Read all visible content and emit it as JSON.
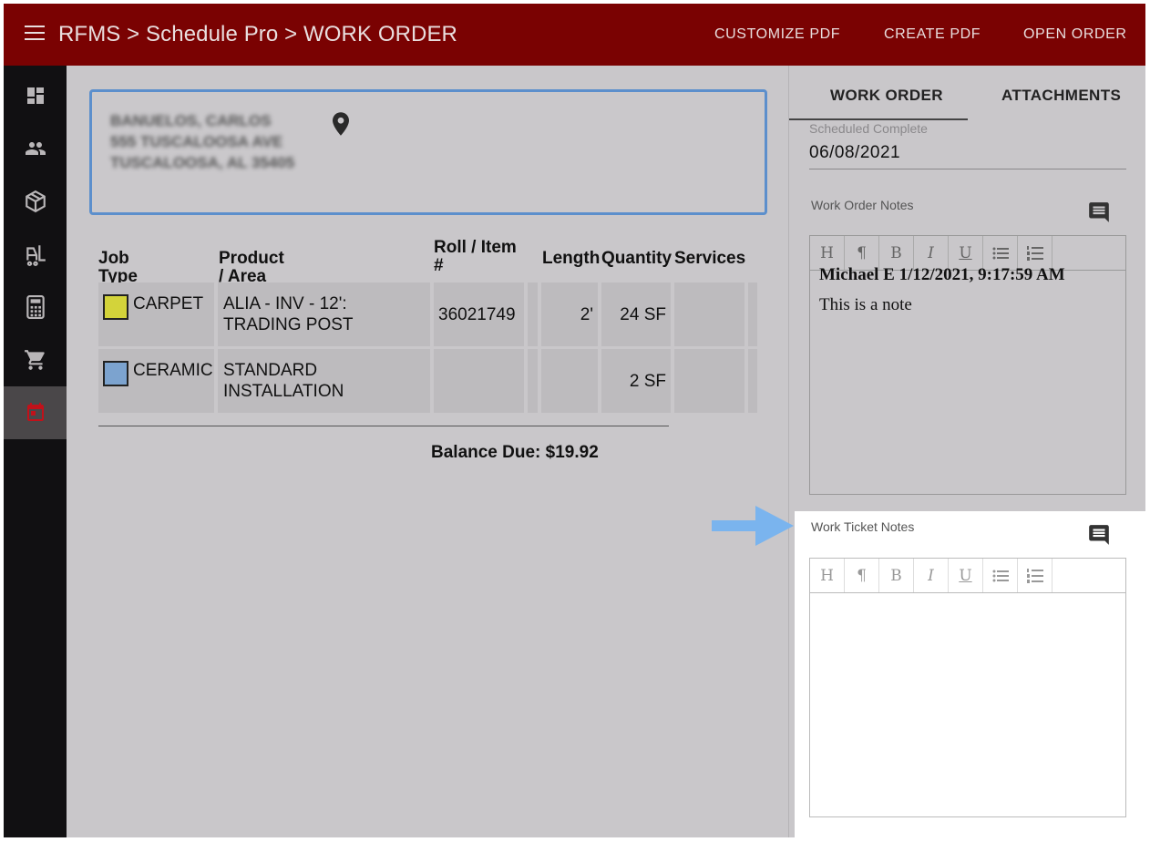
{
  "header": {
    "breadcrumb": "RFMS > Schedule Pro > WORK ORDER",
    "actions": {
      "customize_pdf": "CUSTOMIZE PDF",
      "create_pdf": "CREATE PDF",
      "open_order": "OPEN ORDER"
    }
  },
  "sidebar": {
    "items": [
      {
        "icon": "dashboard-icon"
      },
      {
        "icon": "people-icon"
      },
      {
        "icon": "box-icon"
      },
      {
        "icon": "forklift-icon"
      },
      {
        "icon": "calculator-icon"
      },
      {
        "icon": "cart-icon"
      },
      {
        "icon": "calendar-icon",
        "active": true
      }
    ]
  },
  "customer": {
    "name": "BANUELOS, CARLOS",
    "street": "555 TUSCALOOSA AVE",
    "city": "TUSCALOOSA, AL 35405"
  },
  "table": {
    "headers": {
      "job_type": "Job Type",
      "product": "Product / Area",
      "roll": "Roll / Item #",
      "length": "Length",
      "quantity": "Quantity",
      "services": "Services"
    },
    "rows": [
      {
        "color": "#d3d33a",
        "job_type": "CARPET",
        "product": "ALIA - INV - 12': TRADING POST",
        "roll": "36021749",
        "length": "2'",
        "quantity": "24 SF",
        "services": ""
      },
      {
        "color": "#7ca3cf",
        "job_type": "CERAMIC",
        "product": "STANDARD INSTALLATION",
        "roll": "",
        "length": "",
        "quantity": "2 SF",
        "services": ""
      }
    ]
  },
  "balance": "Balance Due: $19.92",
  "right_panel": {
    "tabs": {
      "work_order": "WORK ORDER",
      "attachments": "ATTACHMENTS"
    },
    "scheduled_complete": {
      "label": "Scheduled Complete",
      "value": "06/08/2021"
    },
    "work_order_notes": {
      "label": "Work Order Notes",
      "author": "Michael E 1/12/2021, 9:17:59 AM",
      "body": "This is a note"
    },
    "work_ticket_notes": {
      "label": "Work Ticket Notes",
      "body": ""
    },
    "toolbar": [
      "H",
      "¶",
      "B",
      "I",
      "U",
      "bulleted-list-icon",
      "numbered-list-icon"
    ]
  },
  "colors": {
    "header": "#7a0202",
    "sidebar": "#111012",
    "highlight_border": "#5c8fcc",
    "arrow": "#7ab4ee"
  }
}
